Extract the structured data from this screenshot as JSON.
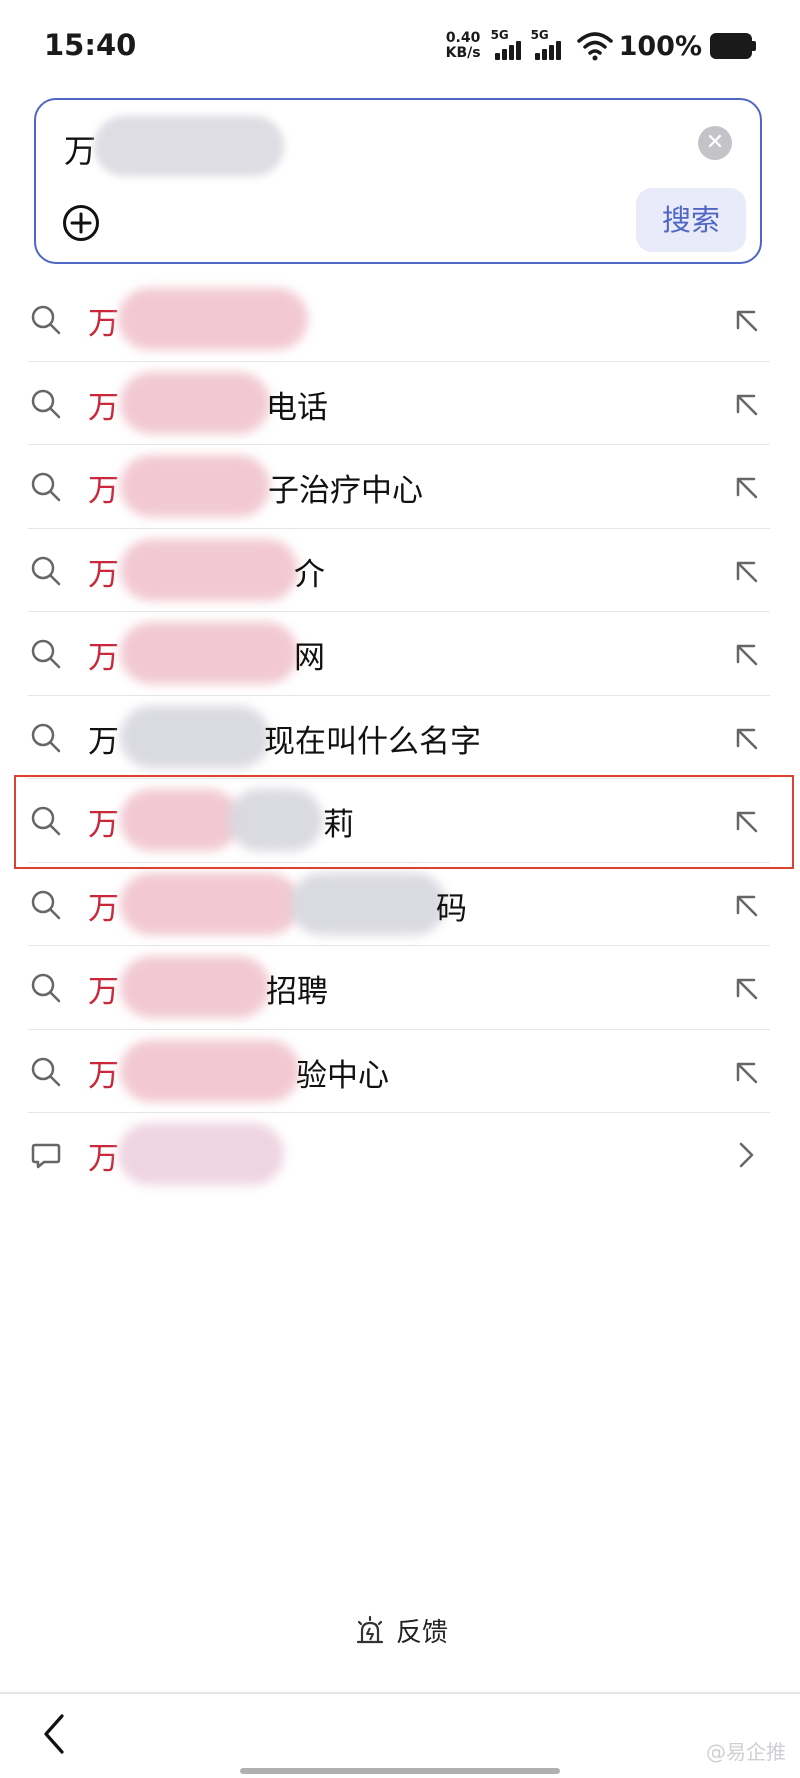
{
  "status_bar": {
    "time": "15:40",
    "net_speed_value": "0.40",
    "net_speed_unit": "KB/s",
    "signal_1": "5G",
    "signal_2": "5G",
    "battery": "100%"
  },
  "search": {
    "query_visible": "万",
    "search_button": "搜索"
  },
  "suggestions": [
    {
      "prefix": "万",
      "suffix": ""
    },
    {
      "prefix": "万",
      "suffix": "电话"
    },
    {
      "prefix": "万",
      "suffix": "子治疗中心"
    },
    {
      "prefix": "万",
      "suffix": "介"
    },
    {
      "prefix": "万",
      "suffix": "网"
    },
    {
      "prefix": "万",
      "suffix": "现在叫什么名字"
    },
    {
      "prefix": "万",
      "suffix": "莉"
    },
    {
      "prefix": "万",
      "suffix": "码"
    },
    {
      "prefix": "万",
      "suffix": "招聘"
    },
    {
      "prefix": "万",
      "suffix": "验中心"
    },
    {
      "prefix": "万",
      "suffix": ""
    }
  ],
  "feedback_label": "反馈",
  "watermark": "@易企推",
  "colors": {
    "accent": "#4f66c4",
    "highlight_text": "#c8283a",
    "annotation_box": "#d9432f"
  }
}
